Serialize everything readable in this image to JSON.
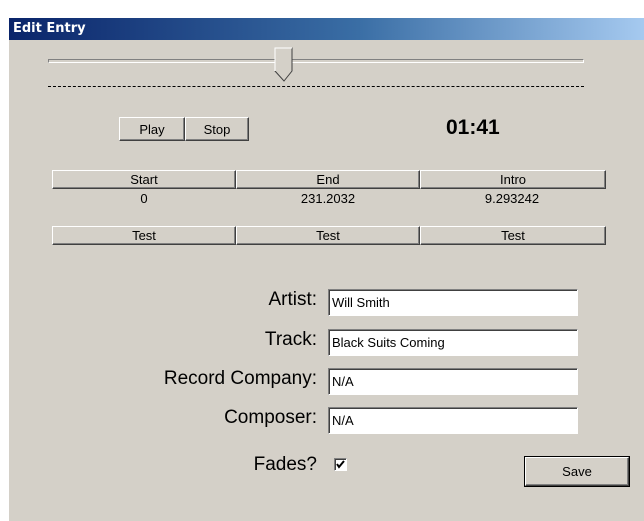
{
  "window": {
    "title": "Edit Entry"
  },
  "transport": {
    "play_label": "Play",
    "stop_label": "Stop",
    "time": "01:41",
    "position_fraction": 0.44
  },
  "markers": {
    "headers": [
      "Start",
      "End",
      "Intro"
    ],
    "values": [
      "0",
      "231.2032",
      "9.293242"
    ],
    "test_labels": [
      "Test",
      "Test",
      "Test"
    ]
  },
  "form": {
    "artist_label": "Artist:",
    "artist_value": "Will Smith",
    "track_label": "Track:",
    "track_value": "Black Suits Coming",
    "record_company_label": "Record Company:",
    "record_company_value": "N/A",
    "composer_label": "Composer:",
    "composer_value": "N/A",
    "fades_label": "Fades?",
    "fades_checked": true,
    "save_label": "Save"
  }
}
